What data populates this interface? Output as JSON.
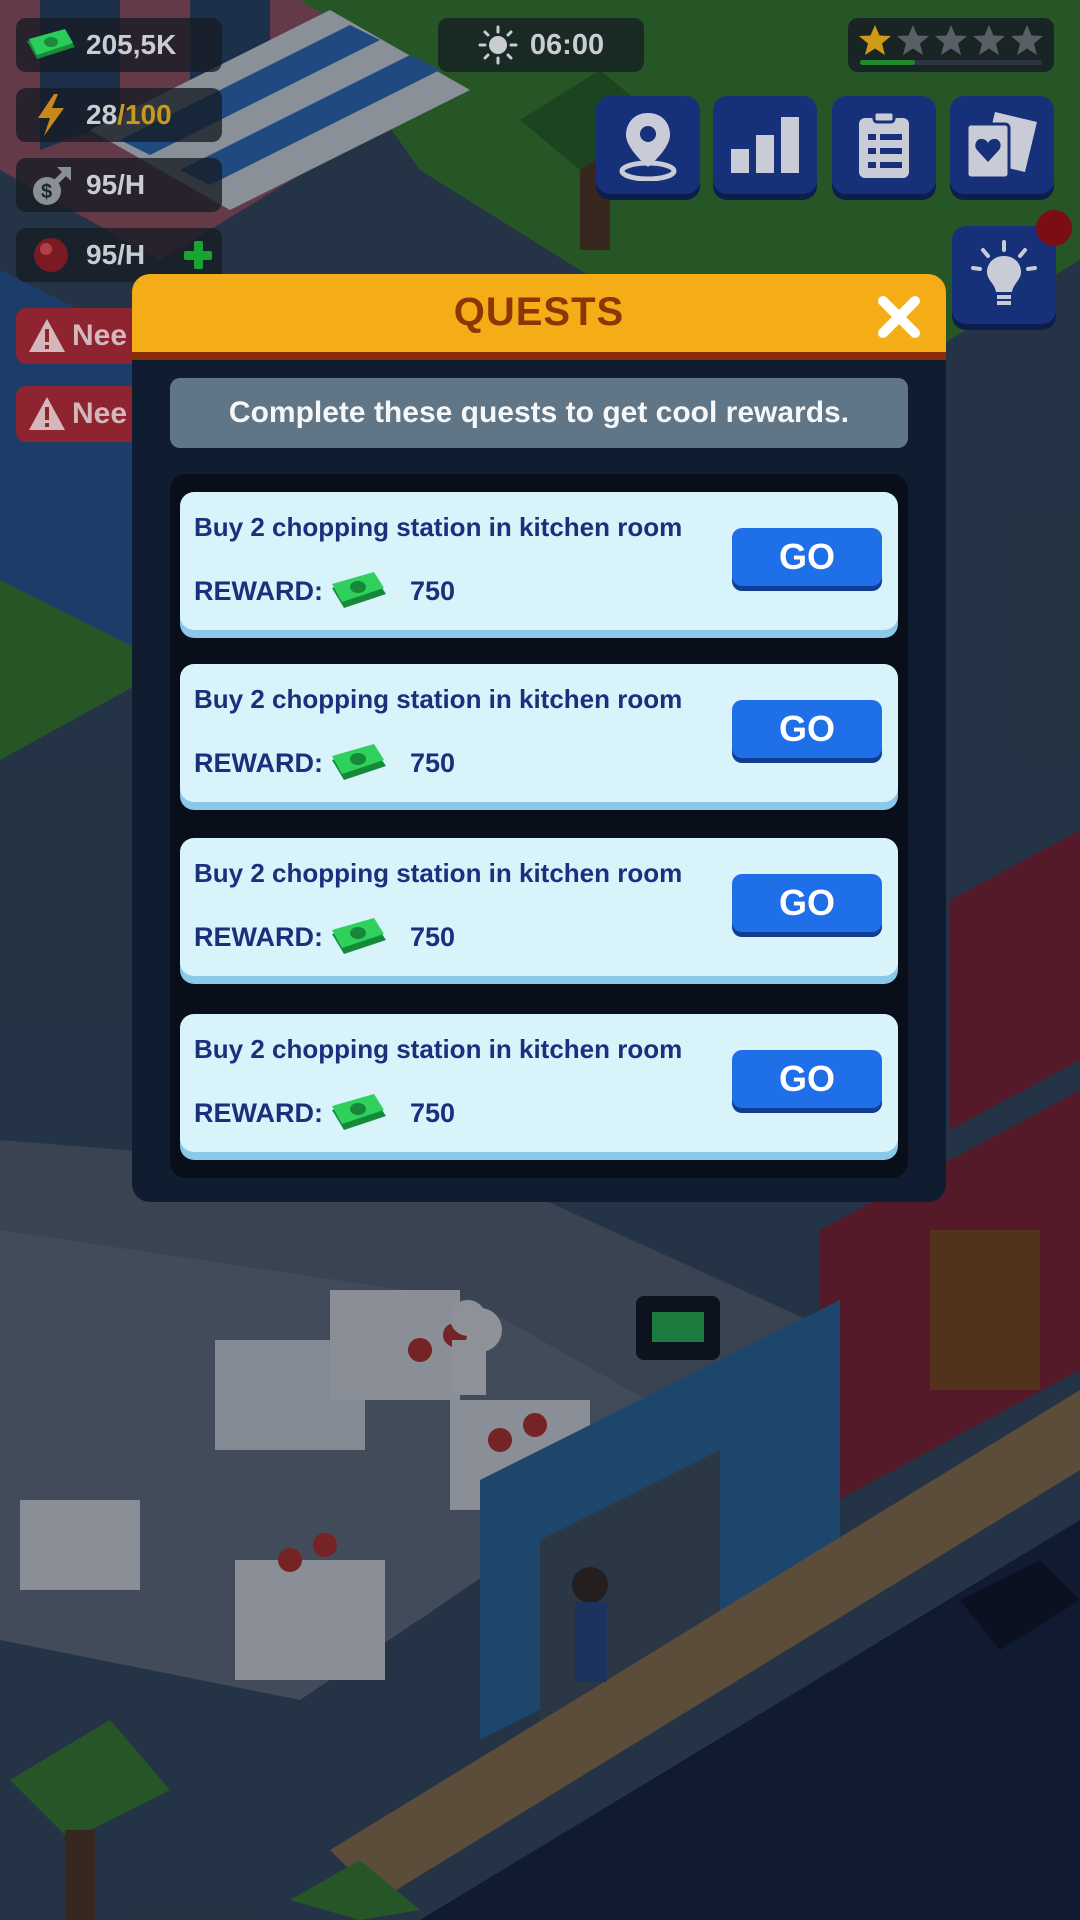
{
  "hud": {
    "cash": "205,5K",
    "energy": "28",
    "energy_max": "/100",
    "income": "95/H",
    "gems": "95/H",
    "warnings": [
      "Nee",
      "Nee"
    ],
    "time": "06:00",
    "star_rating": 1,
    "star_total": 5,
    "star_progress": 0.3,
    "top_buttons": [
      "map-pin-icon",
      "stats-icon",
      "clipboard-icon",
      "cards-icon"
    ],
    "hint_button_icon": "lightbulb-icon"
  },
  "modal": {
    "title": "QUESTS",
    "subtitle": "Complete these quests to get cool rewards.",
    "reward_label": "REWARD:",
    "go_label": "GO",
    "quests": [
      {
        "text": "Buy 2 chopping station in kitchen room",
        "reward": "750"
      },
      {
        "text": "Buy 2 chopping station in kitchen room",
        "reward": "750"
      },
      {
        "text": "Buy 2 chopping station in kitchen room",
        "reward": "750"
      },
      {
        "text": "Buy 2 chopping station in kitchen room",
        "reward": "750"
      }
    ]
  },
  "colors": {
    "header": "#f4ad16",
    "title": "#8c3508",
    "card": "#d9f3fb",
    "button": "#1f6fe8",
    "text": "#1c2f7c"
  }
}
